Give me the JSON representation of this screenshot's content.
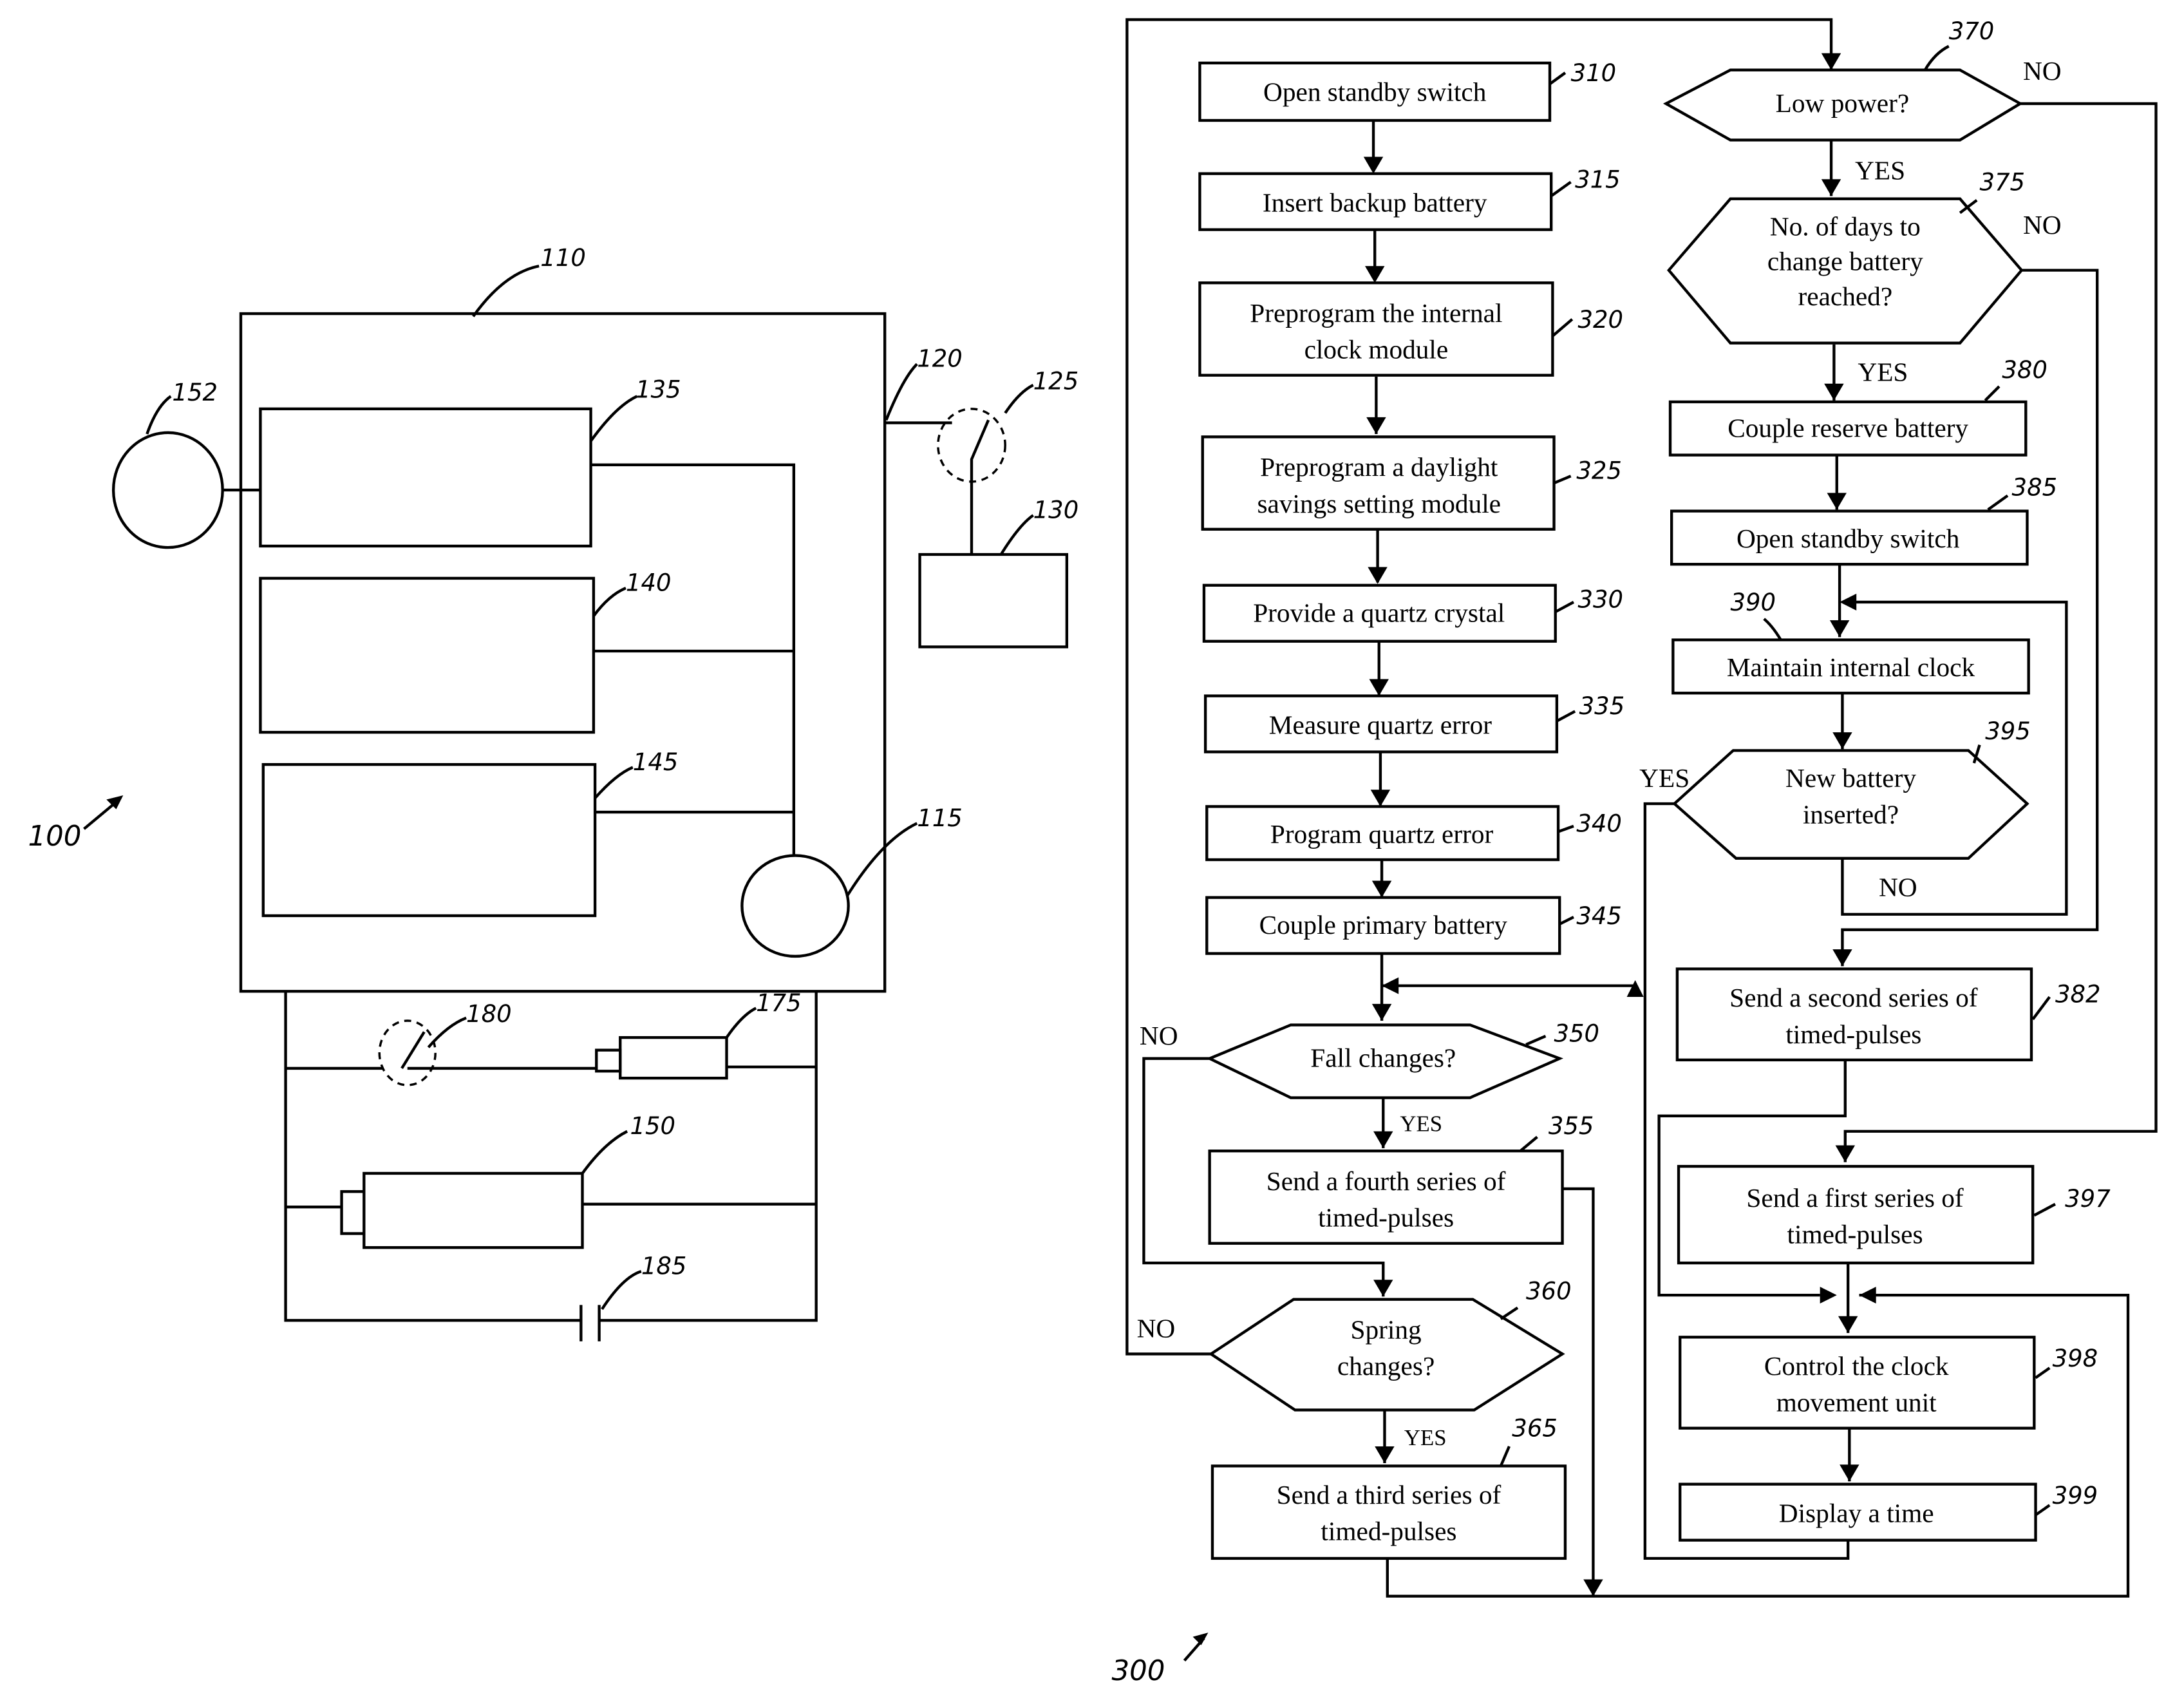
{
  "figure_left": {
    "title_ref": "100",
    "refs": {
      "housing": "110",
      "motor": "115",
      "terminal": "120",
      "switch_top": "125",
      "external_box": "130",
      "module_1": "135",
      "module_2": "140",
      "module_3": "145",
      "primary_battery": "150",
      "sensor": "152",
      "reserve_battery": "175",
      "standby_switch": "180",
      "capacitor": "185"
    }
  },
  "flowchart": {
    "title_ref": "300",
    "steps": {
      "s310": {
        "ref": "310",
        "lines": [
          "Open standby switch"
        ]
      },
      "s315": {
        "ref": "315",
        "lines": [
          "Insert backup battery"
        ]
      },
      "s320": {
        "ref": "320",
        "lines": [
          "Preprogram the internal",
          "clock module"
        ]
      },
      "s325": {
        "ref": "325",
        "lines": [
          "Preprogram a daylight",
          "savings setting module"
        ]
      },
      "s330": {
        "ref": "330",
        "lines": [
          "Provide a quartz crystal"
        ]
      },
      "s335": {
        "ref": "335",
        "lines": [
          "Measure quartz error"
        ]
      },
      "s340": {
        "ref": "340",
        "lines": [
          "Program quartz error"
        ]
      },
      "s345": {
        "ref": "345",
        "lines": [
          "Couple primary battery"
        ]
      },
      "s350": {
        "ref": "350",
        "lines": [
          "Fall changes?"
        ]
      },
      "s355": {
        "ref": "355",
        "lines": [
          "Send a fourth series of",
          "timed-pulses"
        ]
      },
      "s360": {
        "ref": "360",
        "lines": [
          "Spring",
          "changes?"
        ]
      },
      "s365": {
        "ref": "365",
        "lines": [
          "Send a third series of",
          "timed-pulses"
        ]
      },
      "s370": {
        "ref": "370",
        "lines": [
          "Low power?"
        ]
      },
      "s375": {
        "ref": "375",
        "lines": [
          "No. of days to",
          "change battery",
          "reached?"
        ]
      },
      "s380": {
        "ref": "380",
        "lines": [
          "Couple reserve battery"
        ]
      },
      "s385": {
        "ref": "385",
        "lines": [
          "Open standby switch"
        ]
      },
      "s390": {
        "ref": "390",
        "lines": [
          "Maintain internal clock"
        ]
      },
      "s395": {
        "ref": "395",
        "lines": [
          "New battery",
          "inserted?"
        ]
      },
      "s382": {
        "ref": "382",
        "lines": [
          "Send a second series of",
          "timed-pulses"
        ]
      },
      "s397": {
        "ref": "397",
        "lines": [
          "Send a first series of",
          "timed-pulses"
        ]
      },
      "s398": {
        "ref": "398",
        "lines": [
          "Control the clock",
          "movement unit"
        ]
      },
      "s399": {
        "ref": "399",
        "lines": [
          "Display a time"
        ]
      }
    },
    "branch_labels": {
      "yes": "YES",
      "no": "NO"
    }
  }
}
